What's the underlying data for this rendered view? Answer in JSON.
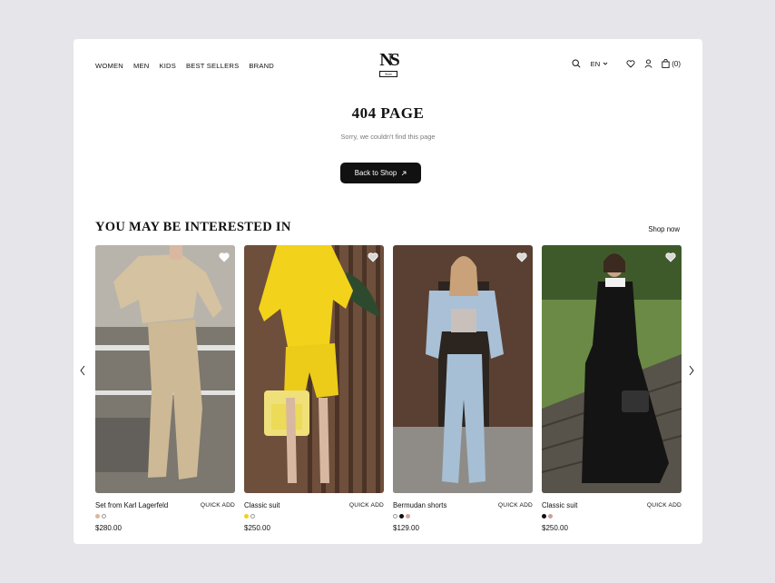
{
  "nav": {
    "items": [
      "WOMEN",
      "MEN",
      "KIDS",
      "BEST SELLERS",
      "BRAND"
    ]
  },
  "logo": {
    "mark": "NS",
    "tag": "Store"
  },
  "header": {
    "language": "EN",
    "cart_count": "(0)",
    "icons": [
      "search-icon",
      "chevron-down-icon",
      "heart-icon",
      "user-icon",
      "bag-icon"
    ]
  },
  "error": {
    "title": "404 PAGE",
    "message": "Sorry, we couldn't find this page",
    "button_label": "Back to Shop"
  },
  "recommendations": {
    "title": "YOU MAY BE INTERESTED IN",
    "shop_now": "Shop now",
    "quick_add": "QUICK ADD",
    "products": [
      {
        "name": "Set from Karl Lagerfeld",
        "price": "$280.00",
        "swatches": [
          "#d8b8a0",
          "#ffffff"
        ]
      },
      {
        "name": "Classic suit",
        "price": "$250.00",
        "swatches": [
          "#f2d21a",
          "#ffffff"
        ]
      },
      {
        "name": "Bermudan shorts",
        "price": "$129.00",
        "swatches": [
          "#ffffff",
          "#111111",
          "#d4a9a0"
        ]
      },
      {
        "name": "Classic suit",
        "price": "$250.00",
        "swatches": [
          "#111111",
          "#c9a39a"
        ]
      }
    ]
  },
  "colors": {
    "accent": "#111111",
    "background": "#e6e5e9",
    "muted_text": "#7a7a7a"
  }
}
